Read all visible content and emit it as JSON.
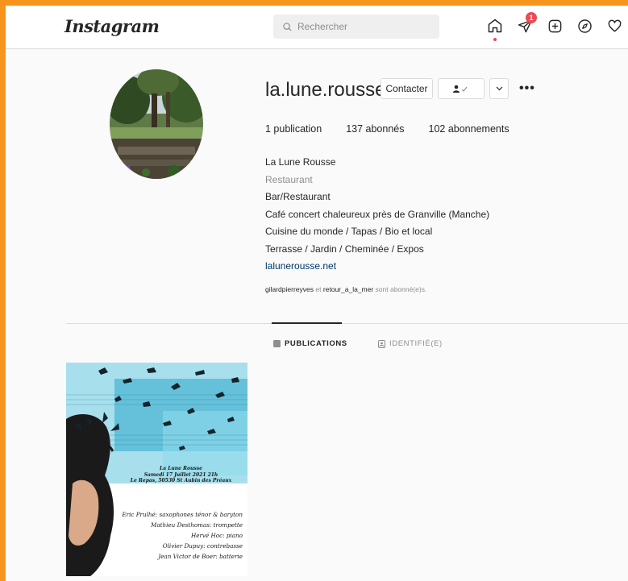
{
  "header": {
    "logo": "Instagram",
    "search_placeholder": "Rechercher",
    "notification_count": "1"
  },
  "profile": {
    "username": "la.lune.rousse",
    "contact_label": "Contacter",
    "stats": {
      "posts": "1 publication",
      "followers": "137 abonnés",
      "following": "102 abonnements"
    },
    "bio": {
      "name": "La Lune Rousse",
      "category": "Restaurant",
      "lines": [
        "Bar/Restaurant",
        "Café concert chaleureux près de Granville (Manche)",
        "Cuisine du monde / Tapas / Bio et local",
        "Terrasse / Jardin / Cheminée / Expos"
      ],
      "website": "lalunerousse.net"
    },
    "followed_by": {
      "user1": "gilardpierreyves",
      "and": " et ",
      "user2": "retour_a_la_mer",
      "suffix": " sont abonné(e)s."
    }
  },
  "tabs": {
    "publications": "PUBLICATIONS",
    "tagged": "IDENTIFIÉ(E)"
  },
  "post": {
    "header_lines": [
      "La Lune Rousse",
      "Samedi 17 Juillet 2021 21h",
      "Le Repas, 50530 St Aubin des Préaux"
    ],
    "credits": [
      "Eric Prulhé: saxophones ténor & baryton",
      "Mathieu Desthomas: trompette",
      "Hervé Hoc: piano",
      "Olivier Dupuy: contrebasse",
      "Jean Victor de Boer: batterie"
    ]
  },
  "colors": {
    "frame": "#f7941d",
    "badge": "#ed4956",
    "link": "#00376b"
  }
}
